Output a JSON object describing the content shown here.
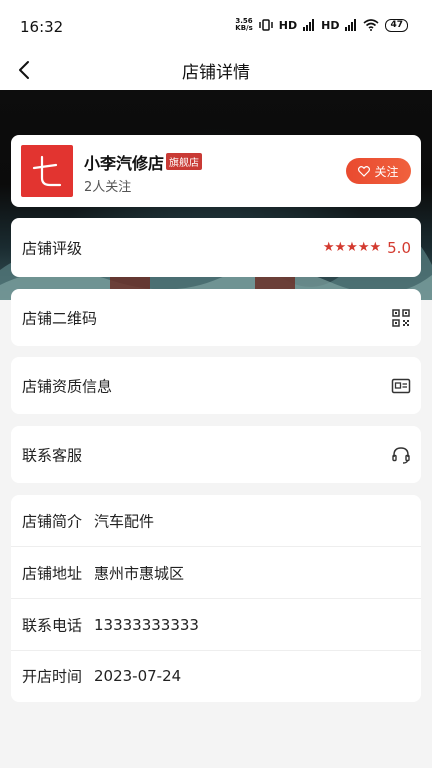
{
  "status_bar": {
    "time": "16:32",
    "net_speed_top": "3.56",
    "net_speed_bottom": "KB/s",
    "signal1": "HD",
    "signal2": "HD",
    "battery": "47"
  },
  "nav": {
    "title": "店铺详情"
  },
  "shop": {
    "logo_char": "七",
    "name": "小李汽修店",
    "badge": "旗舰店",
    "followers": "2人关注",
    "follow_label": "关注"
  },
  "rating": {
    "label": "店铺评级",
    "stars": "★★★★★",
    "value": "5.0"
  },
  "menu": {
    "qr_label": "店铺二维码",
    "qualification_label": "店铺资质信息",
    "service_label": "联系客服"
  },
  "info": [
    {
      "label": "店铺简介",
      "value": "汽车配件"
    },
    {
      "label": "店铺地址",
      "value": "惠州市惠城区"
    },
    {
      "label": "联系电话",
      "value": "13333333333"
    },
    {
      "label": "开店时间",
      "value": "2023-07-24"
    }
  ],
  "colors": {
    "accent": "#e23430",
    "follow_gradient_start": "#e94a2f",
    "follow_gradient_end": "#f0613d",
    "rating": "#d33a2f",
    "background": "#f4f4f4"
  }
}
